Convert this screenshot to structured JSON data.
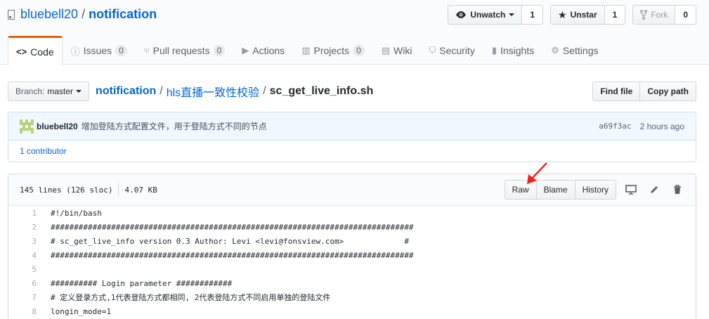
{
  "repo": {
    "owner": "bluebell20",
    "separator": "/",
    "name": "notification"
  },
  "actions": {
    "watch": {
      "label": "Unwatch",
      "count": "1"
    },
    "star": {
      "label": "Unstar",
      "count": "1"
    },
    "fork": {
      "label": "Fork",
      "count": "0"
    }
  },
  "nav": [
    {
      "label": "Code",
      "icon": "<>",
      "counter": ""
    },
    {
      "label": "Issues",
      "icon": "ⓘ",
      "counter": "0"
    },
    {
      "label": "Pull requests",
      "icon": "⑂",
      "counter": "0"
    },
    {
      "label": "Actions",
      "icon": "▶",
      "counter": ""
    },
    {
      "label": "Projects",
      "icon": "▥",
      "counter": "0"
    },
    {
      "label": "Wiki",
      "icon": "▤",
      "counter": ""
    },
    {
      "label": "Security",
      "icon": "⛉",
      "counter": ""
    },
    {
      "label": "Insights",
      "icon": "▮",
      "counter": ""
    },
    {
      "label": "Settings",
      "icon": "⚙",
      "counter": ""
    }
  ],
  "branch": {
    "label": "Branch:",
    "value": "master"
  },
  "breadcrumb": {
    "root": "notification",
    "folder": "hls直播一致性校验",
    "file": "sc_get_live_info.sh",
    "sep": "/"
  },
  "file_actions": {
    "find": "Find file",
    "copy": "Copy path"
  },
  "commit": {
    "author": "bluebell20",
    "message": "增加登陆方式配置文件，用于登陆方式不同的节点",
    "sha": "a69f3ac",
    "time": "2 hours ago",
    "contributors": "1 contributor"
  },
  "file": {
    "lines": "145 lines (126 sloc)",
    "size": "4.07 KB",
    "raw": "Raw",
    "blame": "Blame",
    "history": "History"
  },
  "code": [
    {
      "n": "1",
      "text": "#!/bin/bash"
    },
    {
      "n": "2",
      "text": "##############################################################################"
    },
    {
      "n": "3",
      "text": "# sc_get_live_info version 0.3 Author: Levi <levi@fonsview.com>             #"
    },
    {
      "n": "4",
      "text": "##############################################################################"
    },
    {
      "n": "5",
      "text": ""
    },
    {
      "n": "6",
      "text": "########## Login parameter ############"
    },
    {
      "n": "7",
      "text": "# 定义登录方式,1代表登陆方式都相同, 2代表登陆方式不同启用单独的登陆文件"
    },
    {
      "n": "8",
      "text": "longin_mode=1"
    }
  ],
  "colors": {
    "link": "#0366d6",
    "tab_accent": "#e36209",
    "arrow": "#e8271a",
    "avatar": "#b9d37a"
  }
}
